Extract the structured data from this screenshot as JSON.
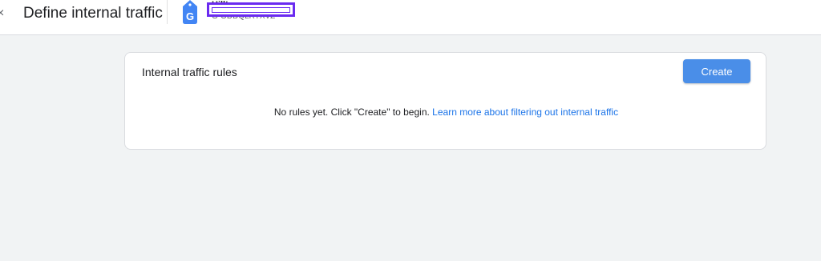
{
  "header": {
    "close_glyph": "×",
    "title": "Define internal traffic",
    "account_name": "Hilltop",
    "account_id": "G-ODDQLRTXVZ",
    "tag_icon": "google-tag-icon"
  },
  "card": {
    "title": "Internal traffic rules",
    "create_label": "Create",
    "empty_text": "No rules yet. Click \"Create\" to begin.",
    "learn_more_link": "Learn more about filtering out internal traffic"
  },
  "colors": {
    "accent": "#1a73e8",
    "button": "#4a8ee8",
    "background": "#f1f3f4",
    "redaction": "#6a2bf0"
  }
}
